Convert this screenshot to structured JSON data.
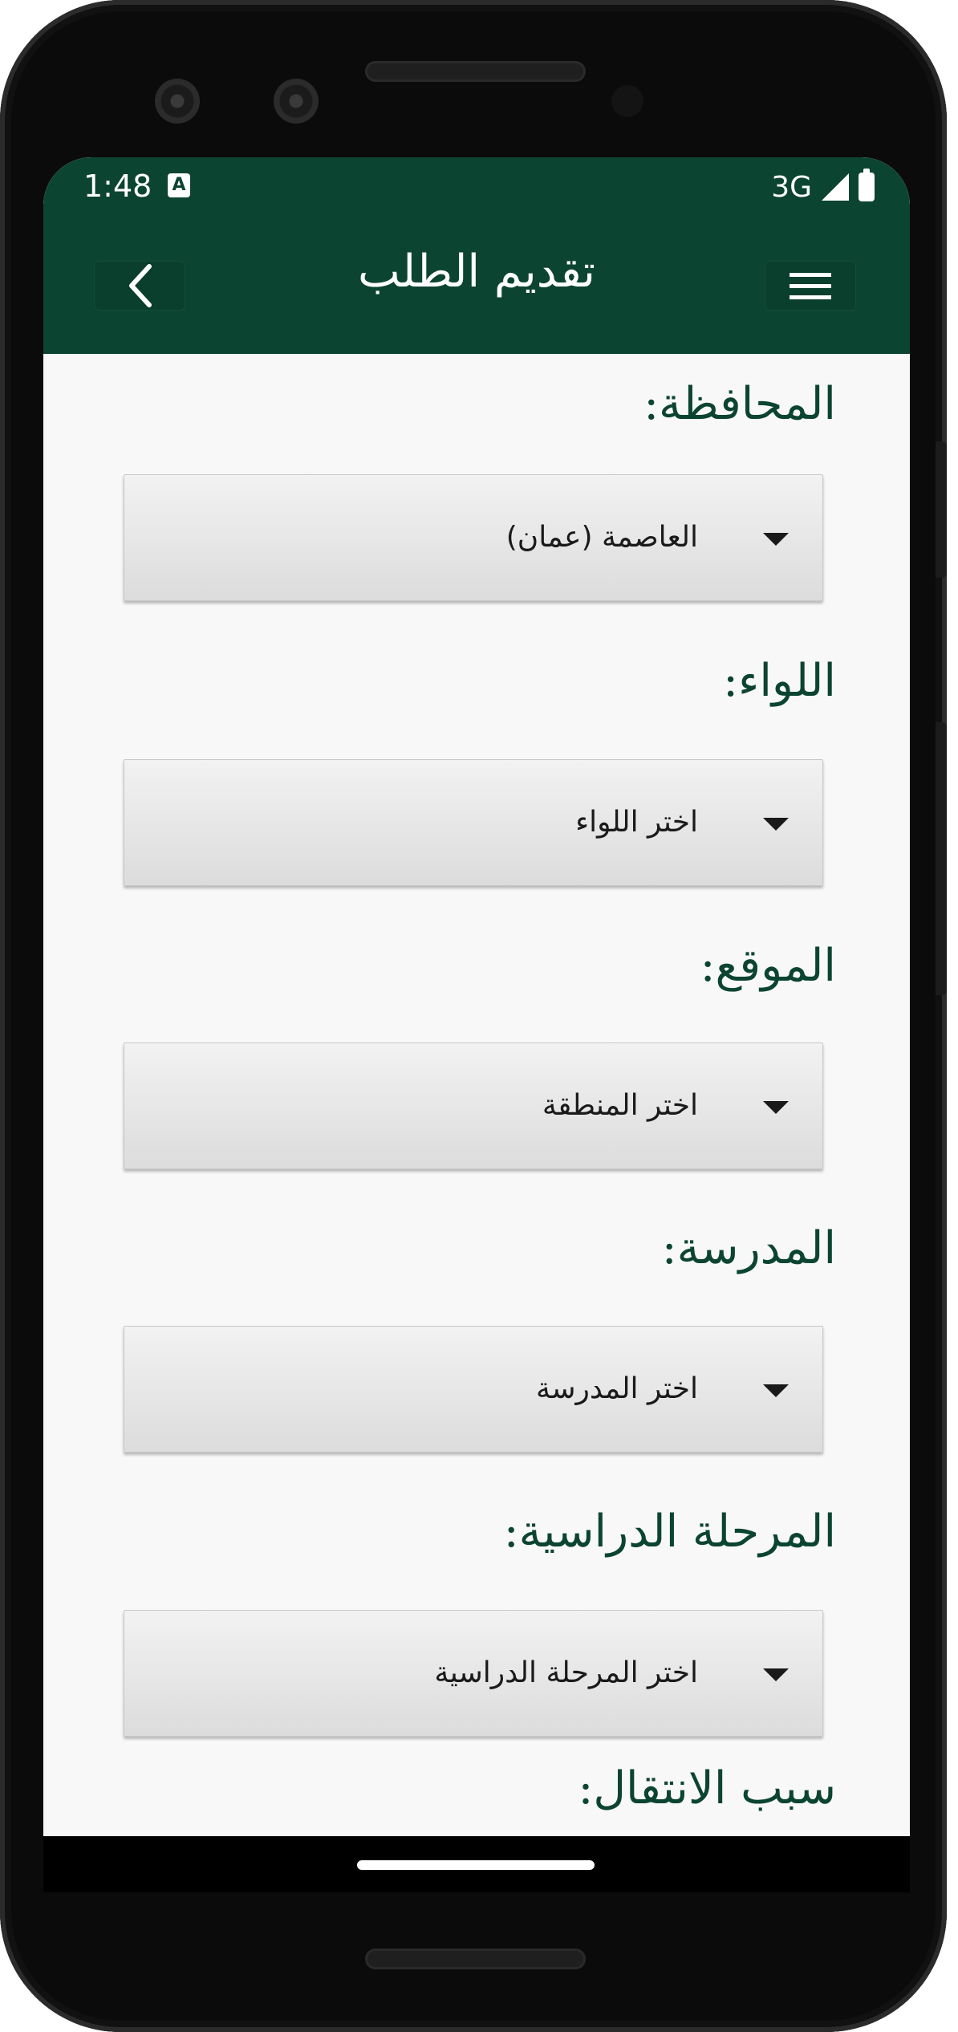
{
  "status_bar": {
    "time": "1:48",
    "network": "3G",
    "indicator_icon": "a-icon"
  },
  "header": {
    "title": "تقديم الطلب",
    "back_icon": "chevron-left-icon",
    "menu_icon": "hamburger-menu-icon"
  },
  "form": {
    "fields": [
      {
        "label": "المحافظة:",
        "value": "العاصمة (عمان)"
      },
      {
        "label": "اللواء:",
        "value": "اختر اللواء"
      },
      {
        "label": "الموقع:",
        "value": "اختر المنطقة"
      },
      {
        "label": "المدرسة:",
        "value": "اختر المدرسة"
      },
      {
        "label": "المرحلة الدراسية:",
        "value": "اختر المرحلة الدراسية"
      }
    ],
    "partial_label": "سبب الانتقال:"
  },
  "colors": {
    "brand": "#0c4432",
    "background": "#f8f8f8"
  }
}
